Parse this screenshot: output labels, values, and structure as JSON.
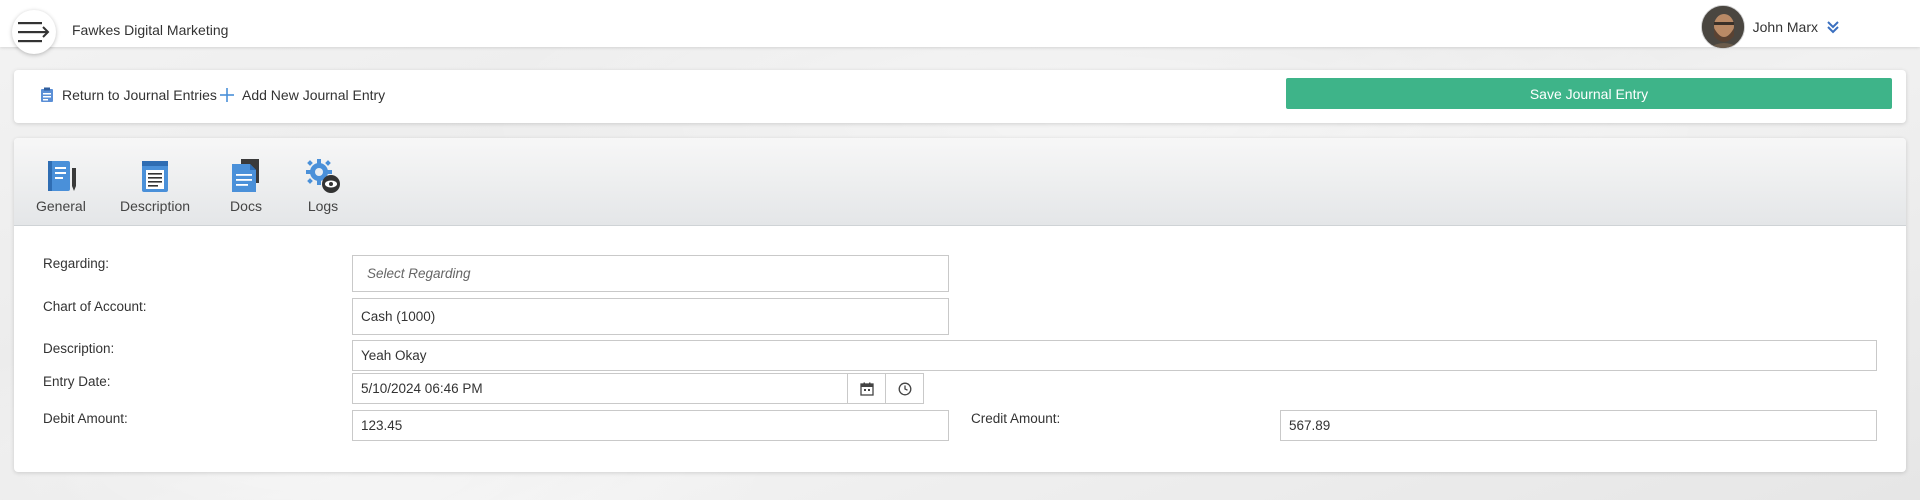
{
  "header": {
    "company_name": "Fawkes Digital Marketing",
    "user_name": "John Marx"
  },
  "actions": {
    "return_label": "Return to Journal Entries",
    "add_label": "Add New Journal Entry",
    "save_label": "Save Journal Entry"
  },
  "tabs": [
    {
      "label": "General",
      "icon": "notebook-icon"
    },
    {
      "label": "Description",
      "icon": "notepad-icon"
    },
    {
      "label": "Docs",
      "icon": "documents-icon"
    },
    {
      "label": "Logs",
      "icon": "gear-eye-icon"
    }
  ],
  "form": {
    "regarding_label": "Regarding:",
    "regarding_placeholder": "Select Regarding",
    "chart_label": "Chart of Account:",
    "chart_value": "Cash (1000)",
    "description_label": "Description:",
    "description_value": "Yeah Okay",
    "entry_date_label": "Entry Date:",
    "entry_date_value": "5/10/2024 06:46 PM",
    "debit_label": "Debit Amount:",
    "debit_value": "123.45",
    "credit_label": "Credit Amount:",
    "credit_value": "567.89"
  },
  "colors": {
    "save_button": "#3eb489",
    "icon_blue": "#4a90d9"
  }
}
